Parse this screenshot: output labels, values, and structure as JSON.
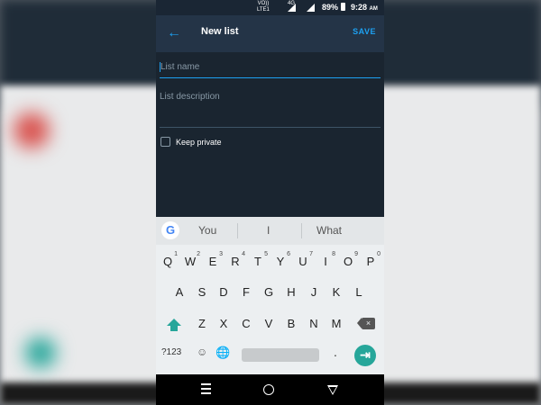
{
  "status_bar": {
    "network_top": "VO))",
    "network_bottom": "LTE1",
    "data_type": "4G",
    "battery_percent": "89%",
    "time": "9:28",
    "ampm": "AM"
  },
  "toolbar": {
    "back_icon": "arrow-left-icon",
    "title": "New list",
    "save_label": "SAVE"
  },
  "form": {
    "list_name_placeholder": "List name",
    "list_description_placeholder": "List description",
    "keep_private_label": "Keep private",
    "keep_private_checked": false
  },
  "keyboard": {
    "suggestions": [
      "You",
      "I",
      "What"
    ],
    "row1": [
      {
        "key": "Q",
        "hint": "1"
      },
      {
        "key": "W",
        "hint": "2"
      },
      {
        "key": "E",
        "hint": "3"
      },
      {
        "key": "R",
        "hint": "4"
      },
      {
        "key": "T",
        "hint": "5"
      },
      {
        "key": "Y",
        "hint": "6"
      },
      {
        "key": "U",
        "hint": "7"
      },
      {
        "key": "I",
        "hint": "8"
      },
      {
        "key": "O",
        "hint": "9"
      },
      {
        "key": "P",
        "hint": "0"
      }
    ],
    "row2": [
      "A",
      "S",
      "D",
      "F",
      "G",
      "H",
      "J",
      "K",
      "L"
    ],
    "row3": [
      "Z",
      "X",
      "C",
      "V",
      "B",
      "N",
      "M"
    ],
    "symbols_label": "?123",
    "period_label": ".",
    "enter_icon": "arrow-right-bar-icon",
    "accent_color": "#26a69a"
  },
  "colors": {
    "app_background": "#1a2530",
    "toolbar": "#243447",
    "accent": "#1da1f2"
  }
}
